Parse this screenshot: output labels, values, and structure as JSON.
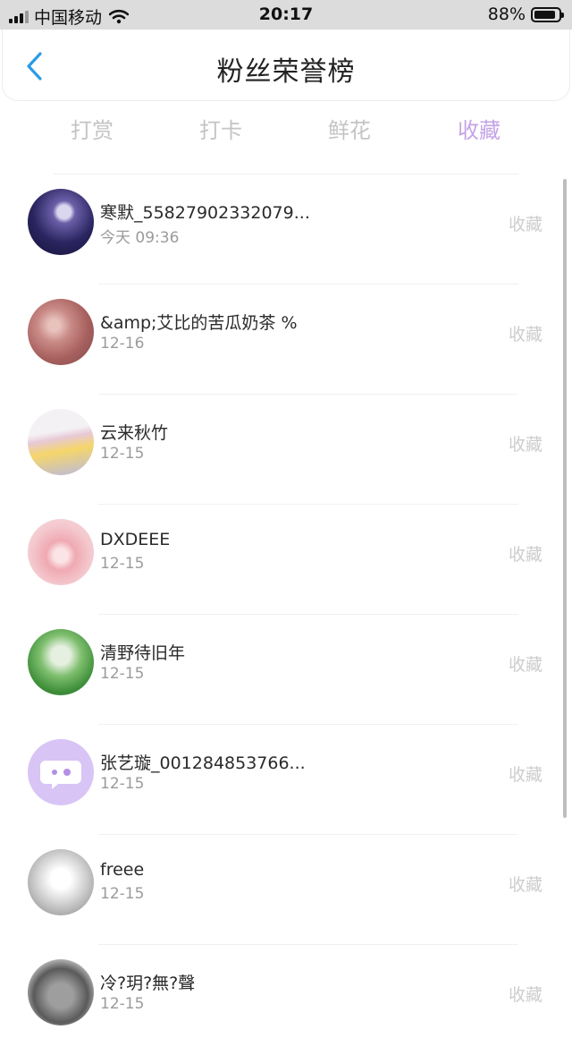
{
  "status_bar": {
    "carrier": "中国移动",
    "time": "20:17",
    "battery": "88%",
    "battery_level": 0.88
  },
  "header": {
    "back_icon": "chevron-left-icon",
    "title": "粉丝荣誉榜",
    "accent": "#2a9be8"
  },
  "tabs": [
    {
      "label": "打赏",
      "active": false
    },
    {
      "label": "打卡",
      "active": false
    },
    {
      "label": "鲜花",
      "active": false
    },
    {
      "label": "收藏",
      "active": true
    }
  ],
  "active_color": "#c5a3e6",
  "list": [
    {
      "name": "寒默_55827902332079...",
      "time": "今天 09:36",
      "action": "收藏"
    },
    {
      "name": "&amp;艾比的苦瓜奶茶 %",
      "time": "12-16",
      "action": "收藏"
    },
    {
      "name": "云来秋竹",
      "time": "12-15",
      "action": "收藏"
    },
    {
      "name": "DXDEEE",
      "time": "12-15",
      "action": "收藏"
    },
    {
      "name": "清野待旧年",
      "time": "12-15",
      "action": "收藏"
    },
    {
      "name": "张艺璇_001284853766...",
      "time": "12-15",
      "action": "收藏"
    },
    {
      "name": "freee",
      "time": "12-15",
      "action": "收藏"
    },
    {
      "name": "冷?玥?無?聲",
      "time": "12-15",
      "action": "收藏"
    }
  ]
}
